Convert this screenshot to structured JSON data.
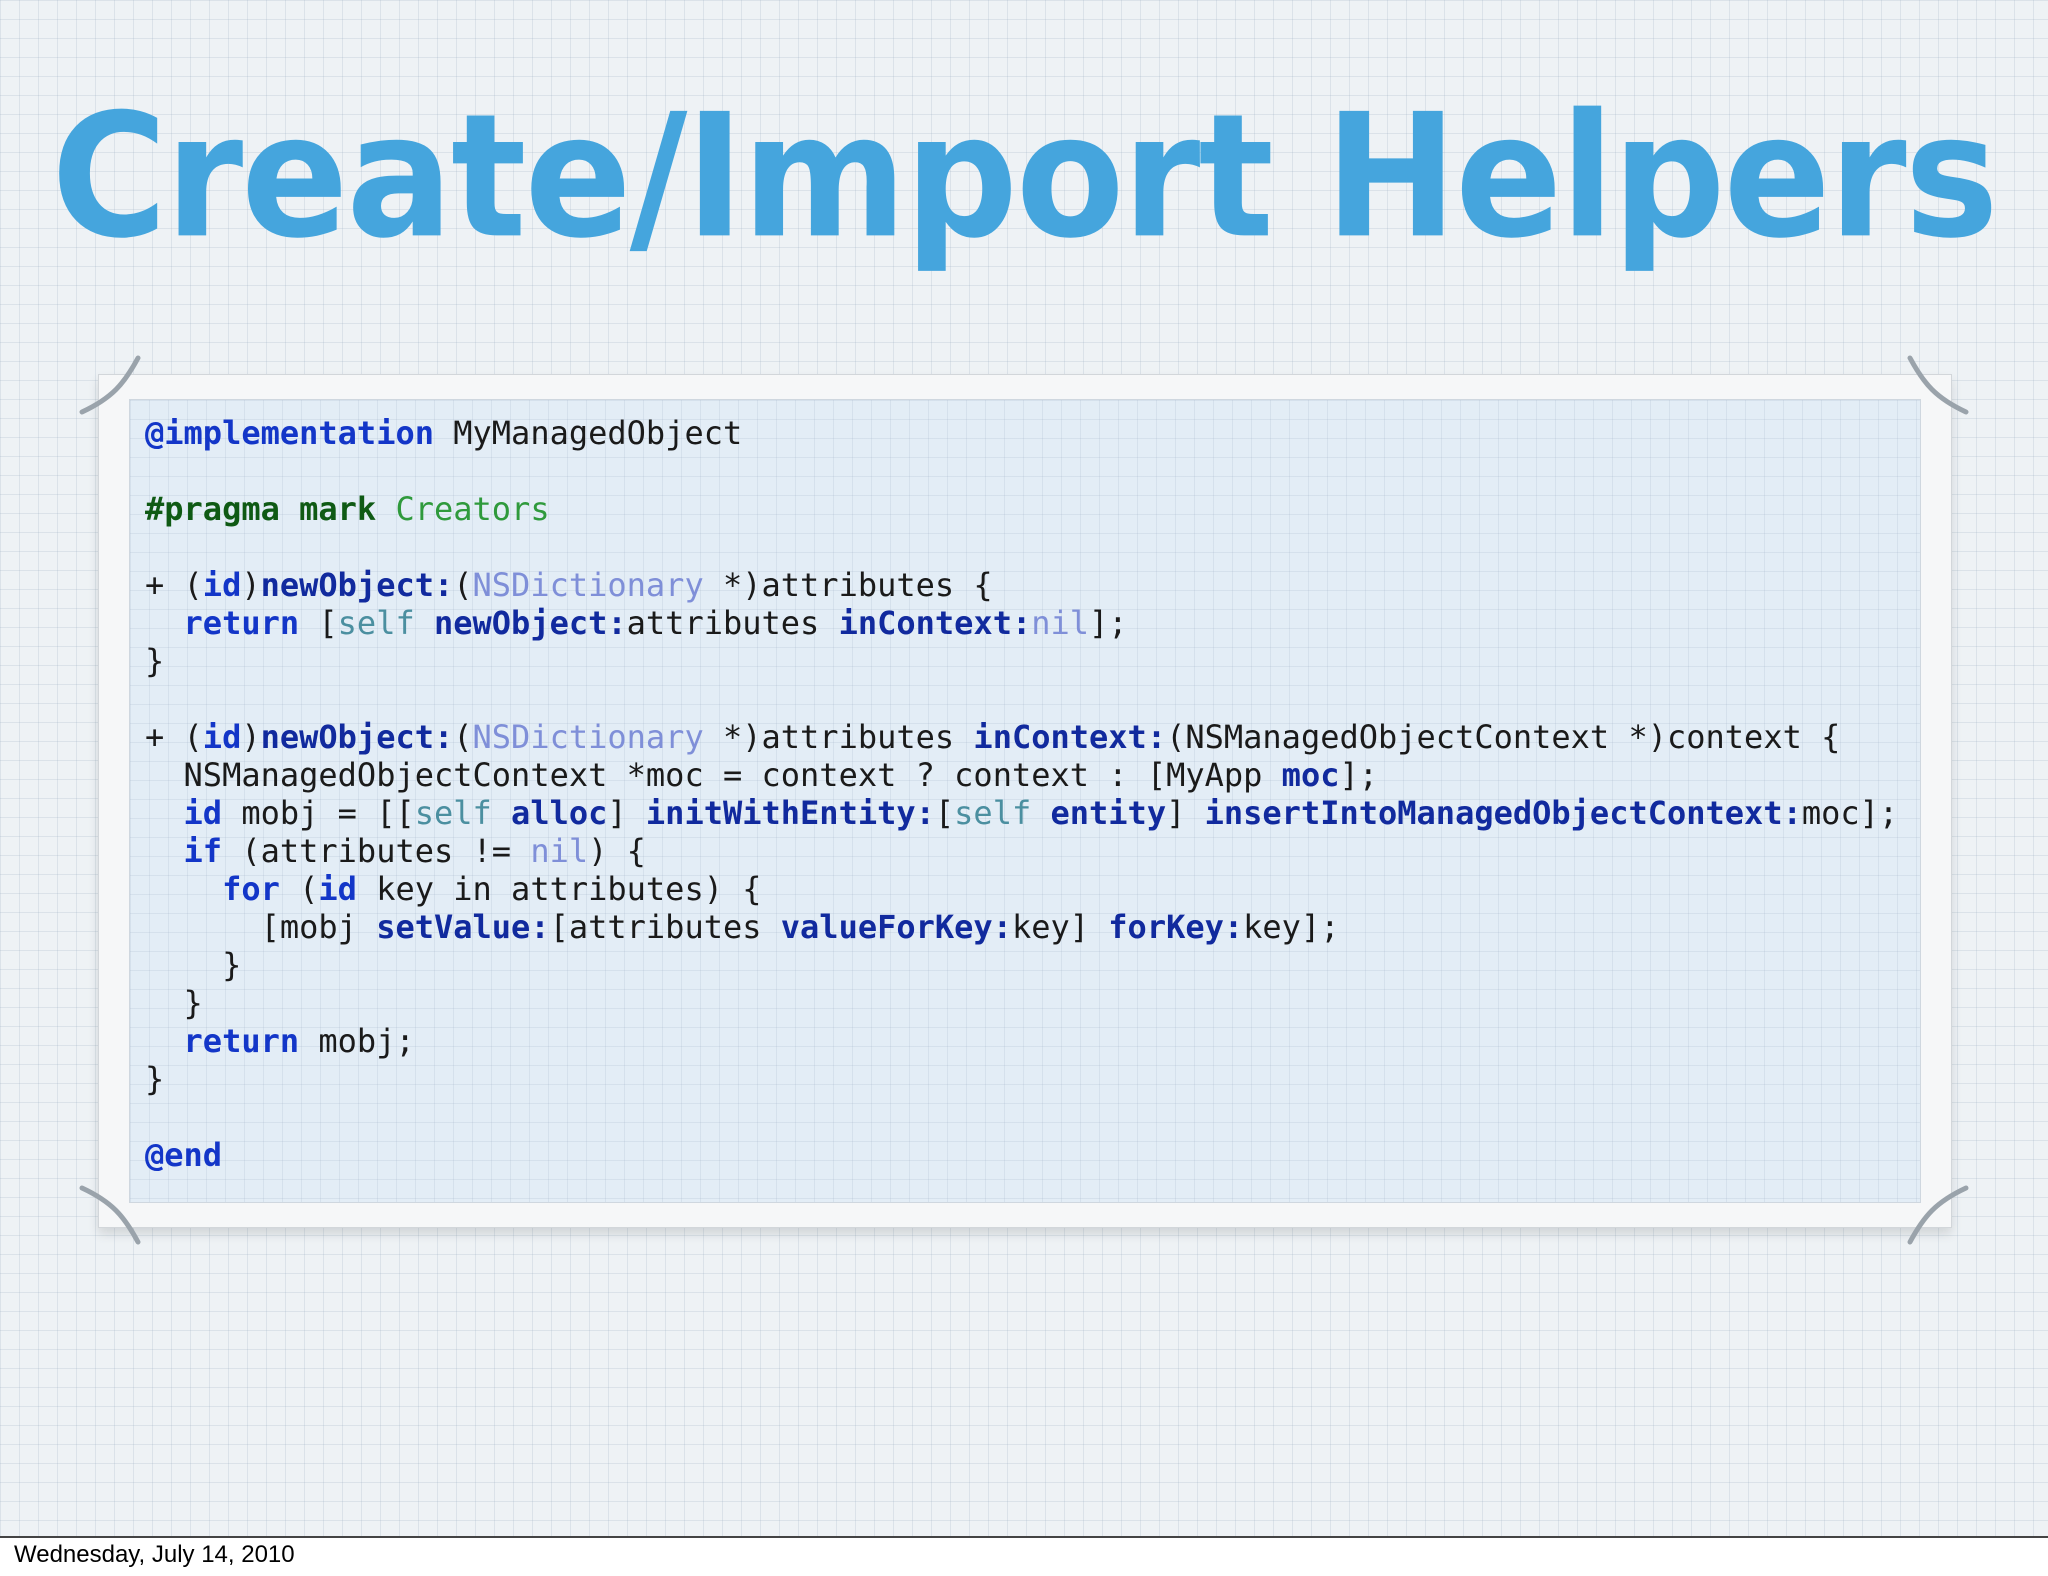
{
  "slide": {
    "title": "Create/Import Helpers",
    "footer_date": "Wednesday, July 14, 2010"
  },
  "colors": {
    "title": "#45a5dd",
    "keyword": "#1336c8",
    "message": "#112a9e",
    "class": "#7f8fd8",
    "self": "#4b8fa0",
    "pragma": "#0f5a14",
    "pragma_text": "#2f9a3c"
  },
  "code": {
    "lines": [
      [
        {
          "t": "@implementation",
          "c": "kw"
        },
        {
          "t": " MyManagedObject",
          "c": ""
        }
      ],
      [],
      [
        {
          "t": "#pragma mark",
          "c": "pre"
        },
        {
          "t": " Creators",
          "c": "prebody"
        }
      ],
      [],
      [
        {
          "t": "+ (",
          "c": ""
        },
        {
          "t": "id",
          "c": "kw"
        },
        {
          "t": ")",
          "c": ""
        },
        {
          "t": "newObject:",
          "c": "msg"
        },
        {
          "t": "(",
          "c": ""
        },
        {
          "t": "NSDictionary",
          "c": "cls"
        },
        {
          "t": " *)attributes {",
          "c": ""
        }
      ],
      [
        {
          "t": "  ",
          "c": ""
        },
        {
          "t": "return",
          "c": "kw"
        },
        {
          "t": " [",
          "c": ""
        },
        {
          "t": "self",
          "c": "self"
        },
        {
          "t": " ",
          "c": ""
        },
        {
          "t": "newObject:",
          "c": "msg"
        },
        {
          "t": "attributes ",
          "c": ""
        },
        {
          "t": "inContext:",
          "c": "msg"
        },
        {
          "t": "nil",
          "c": "nil"
        },
        {
          "t": "];",
          "c": ""
        }
      ],
      [
        {
          "t": "}",
          "c": ""
        }
      ],
      [],
      [
        {
          "t": "+ (",
          "c": ""
        },
        {
          "t": "id",
          "c": "kw"
        },
        {
          "t": ")",
          "c": ""
        },
        {
          "t": "newObject:",
          "c": "msg"
        },
        {
          "t": "(",
          "c": ""
        },
        {
          "t": "NSDictionary",
          "c": "cls"
        },
        {
          "t": " *)attributes ",
          "c": ""
        },
        {
          "t": "inContext:",
          "c": "msg"
        },
        {
          "t": "(NSManagedObjectContext *)context {",
          "c": ""
        }
      ],
      [
        {
          "t": "  NSManagedObjectContext *moc = context ? context : [MyApp ",
          "c": ""
        },
        {
          "t": "moc",
          "c": "msg"
        },
        {
          "t": "];",
          "c": ""
        }
      ],
      [
        {
          "t": "  ",
          "c": ""
        },
        {
          "t": "id",
          "c": "kw"
        },
        {
          "t": " mobj = [[",
          "c": ""
        },
        {
          "t": "self",
          "c": "self"
        },
        {
          "t": " ",
          "c": ""
        },
        {
          "t": "alloc",
          "c": "msg"
        },
        {
          "t": "] ",
          "c": ""
        },
        {
          "t": "initWithEntity:",
          "c": "msg"
        },
        {
          "t": "[",
          "c": ""
        },
        {
          "t": "self",
          "c": "self"
        },
        {
          "t": " ",
          "c": ""
        },
        {
          "t": "entity",
          "c": "msg"
        },
        {
          "t": "] ",
          "c": ""
        },
        {
          "t": "insertIntoManagedObjectContext:",
          "c": "msg"
        },
        {
          "t": "moc];",
          "c": ""
        }
      ],
      [
        {
          "t": "  ",
          "c": ""
        },
        {
          "t": "if",
          "c": "kw"
        },
        {
          "t": " (attributes != ",
          "c": ""
        },
        {
          "t": "nil",
          "c": "nil"
        },
        {
          "t": ") {",
          "c": ""
        }
      ],
      [
        {
          "t": "    ",
          "c": ""
        },
        {
          "t": "for",
          "c": "kw"
        },
        {
          "t": " (",
          "c": ""
        },
        {
          "t": "id",
          "c": "kw"
        },
        {
          "t": " key in attributes) {",
          "c": ""
        }
      ],
      [
        {
          "t": "      [mobj ",
          "c": ""
        },
        {
          "t": "setValue:",
          "c": "msg"
        },
        {
          "t": "[attributes ",
          "c": ""
        },
        {
          "t": "valueForKey:",
          "c": "msg"
        },
        {
          "t": "key] ",
          "c": ""
        },
        {
          "t": "forKey:",
          "c": "msg"
        },
        {
          "t": "key];",
          "c": ""
        }
      ],
      [
        {
          "t": "    }",
          "c": ""
        }
      ],
      [
        {
          "t": "  }",
          "c": ""
        }
      ],
      [
        {
          "t": "  ",
          "c": ""
        },
        {
          "t": "return",
          "c": "kw"
        },
        {
          "t": " mobj;",
          "c": ""
        }
      ],
      [
        {
          "t": "}",
          "c": ""
        }
      ],
      [],
      [
        {
          "t": "@end",
          "c": "kw"
        }
      ]
    ]
  }
}
